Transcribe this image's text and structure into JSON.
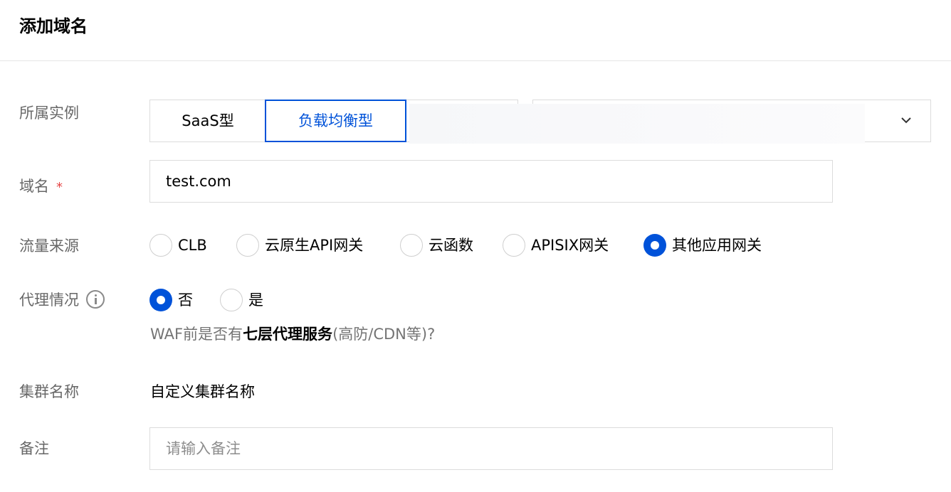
{
  "header": {
    "title": "添加域名"
  },
  "instance": {
    "label": "所属实例",
    "options": [
      "SaaS型",
      "负载均衡型"
    ],
    "selected": "负载均衡型"
  },
  "domain": {
    "label": "域名",
    "required_mark": "*",
    "value": "test.com"
  },
  "traffic_source": {
    "label": "流量来源",
    "options": [
      "CLB",
      "云原生API网关",
      "云函数",
      "APISIX网关",
      "其他应用网关"
    ],
    "selected": "其他应用网关"
  },
  "proxy": {
    "label": "代理情况",
    "options": [
      "否",
      "是"
    ],
    "selected": "否",
    "hint_prefix": "WAF前是否有",
    "hint_bold": "七层代理服务",
    "hint_suffix": "(高防/CDN等)?"
  },
  "cluster": {
    "label": "集群名称",
    "value": "自定义集群名称"
  },
  "remark": {
    "label": "备注",
    "placeholder": "请输入备注"
  },
  "colors": {
    "accent": "#0052d9",
    "required": "#e54545"
  }
}
